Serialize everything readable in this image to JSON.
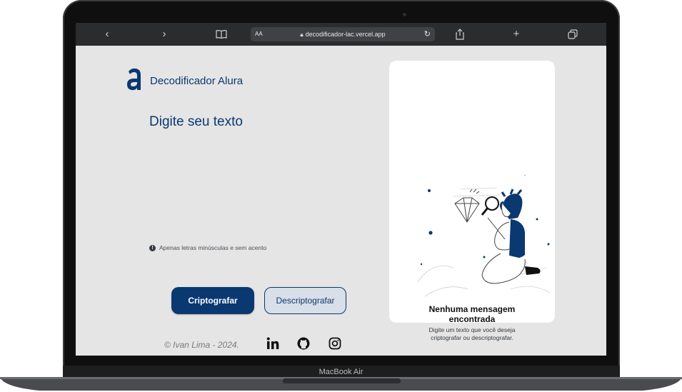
{
  "device": {
    "model_label": "MacBook Air"
  },
  "browser": {
    "back_icon": "chevron-left-icon",
    "forward_icon": "chevron-right-icon",
    "bookmarks_icon": "book-icon",
    "reader_label": "AA",
    "url": "decodificador-lac.vercel.app",
    "share_icon": "share-icon",
    "new_tab_icon": "plus-icon",
    "tabs_icon": "tabs-icon"
  },
  "app": {
    "brand_name": "Decodificador Alura",
    "input_placeholder": "Digite seu texto",
    "hint": "Apenas letras minúsculas e sem acento",
    "encrypt_label": "Criptografar",
    "decrypt_label": "Descriptografar",
    "footer_credit": "© Ivan Lima - 2024.",
    "social": [
      "linkedin-icon",
      "github-icon",
      "instagram-icon"
    ]
  },
  "result": {
    "title_line1": "Nenhuma mensagem",
    "title_line2": "encontrada",
    "desc_line1": "Digite um texto que você deseja",
    "desc_line2": "criptografar ou descriptografar."
  },
  "colors": {
    "primary": "#0a3871",
    "background": "#e5e5e5",
    "card": "#ffffff"
  }
}
